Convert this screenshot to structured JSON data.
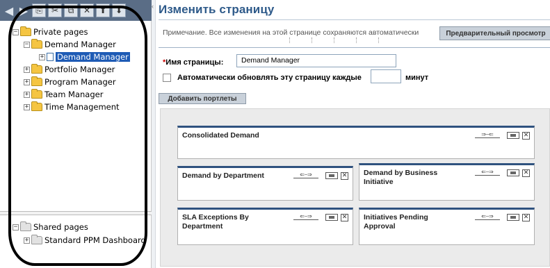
{
  "sidebar": {
    "toolbar": {
      "back": "◀",
      "forward": "▶",
      "copy": "⎘",
      "cut": "✂",
      "paste": "⧉",
      "delete": "✕",
      "up": "⬆",
      "down": "⬇"
    },
    "tree": {
      "private_pages": "Private pages",
      "demand_manager_folder": "Demand Manager",
      "demand_manager_page": "Demand Manager",
      "portfolio_manager": "Portfolio Manager",
      "program_manager": "Program Manager",
      "team_manager": "Team Manager",
      "time_management": "Time Management",
      "shared_pages": "Shared pages",
      "standard_ppm_dashboard": "Standard PPM Dashboard"
    }
  },
  "main": {
    "title": "Изменить страницу",
    "note": "Примечание. Все изменения на этой странице сохраняются автоматически",
    "preview_button": "Предварительный просмотр",
    "page_name_label": "Имя страницы:",
    "page_name_required": "*",
    "page_name_value": "Demand Manager",
    "auto_refresh_label": "Автоматически обновлять эту страницу каждые",
    "minutes_label": "минут",
    "minutes_value": "",
    "add_portlets_button": "Добавить портлеты"
  },
  "portlets": [
    {
      "title": "Consolidated Demand",
      "move": "⇒⎯⇐"
    },
    {
      "title": "Demand by Department",
      "move": "⇐⎯⇒"
    },
    {
      "title": "Demand by Business Initiative",
      "move": "⇐⎯⇒"
    },
    {
      "title": "SLA Exceptions By Department",
      "move": "⇐⎯⇒"
    },
    {
      "title": "Initiatives Pending Approval",
      "move": "⇐⎯⇒"
    }
  ],
  "colors": {
    "toolbar": "#5a6d86",
    "title": "#2e5a8a",
    "selected": "#1e5bb5",
    "portlet_border": "#2f527f"
  }
}
